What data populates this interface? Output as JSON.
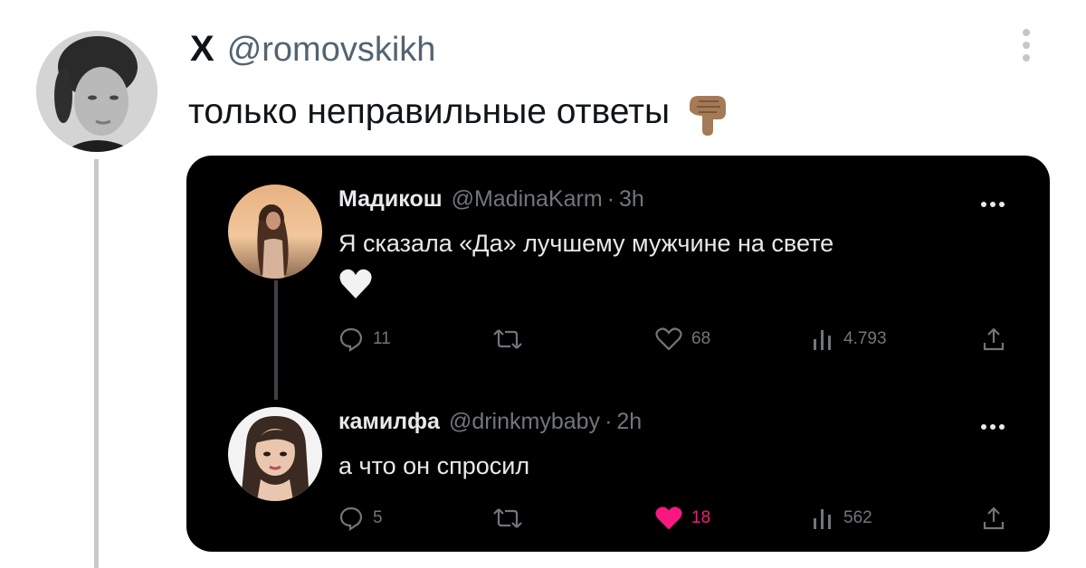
{
  "outer_tweet": {
    "author_name": "X",
    "author_handle": "@romovskikh",
    "text": "только неправильные ответы",
    "emoji": "backhand-index-pointing-down-icon"
  },
  "quoted_thread": [
    {
      "name": "Мадикош",
      "handle": "@MadinaKarm",
      "separator": "·",
      "time": "3h",
      "text": "Я сказала «Да» лучшему мужчине на свете",
      "emoji": "white-heart-icon",
      "actions": {
        "replies": "11",
        "reposts": "",
        "likes": "68",
        "views": "4.793"
      },
      "liked": false
    },
    {
      "name": "камилфа",
      "handle": "@drinkmybaby",
      "separator": "·",
      "time": "2h",
      "text": "а что он спросил",
      "actions": {
        "replies": "5",
        "reposts": "",
        "likes": "18",
        "views": "562"
      },
      "liked": true
    }
  ],
  "colors": {
    "card_background": "#000000",
    "liked": "#f91880",
    "muted": "#71767b",
    "thread_line": "#c6c9cc"
  }
}
